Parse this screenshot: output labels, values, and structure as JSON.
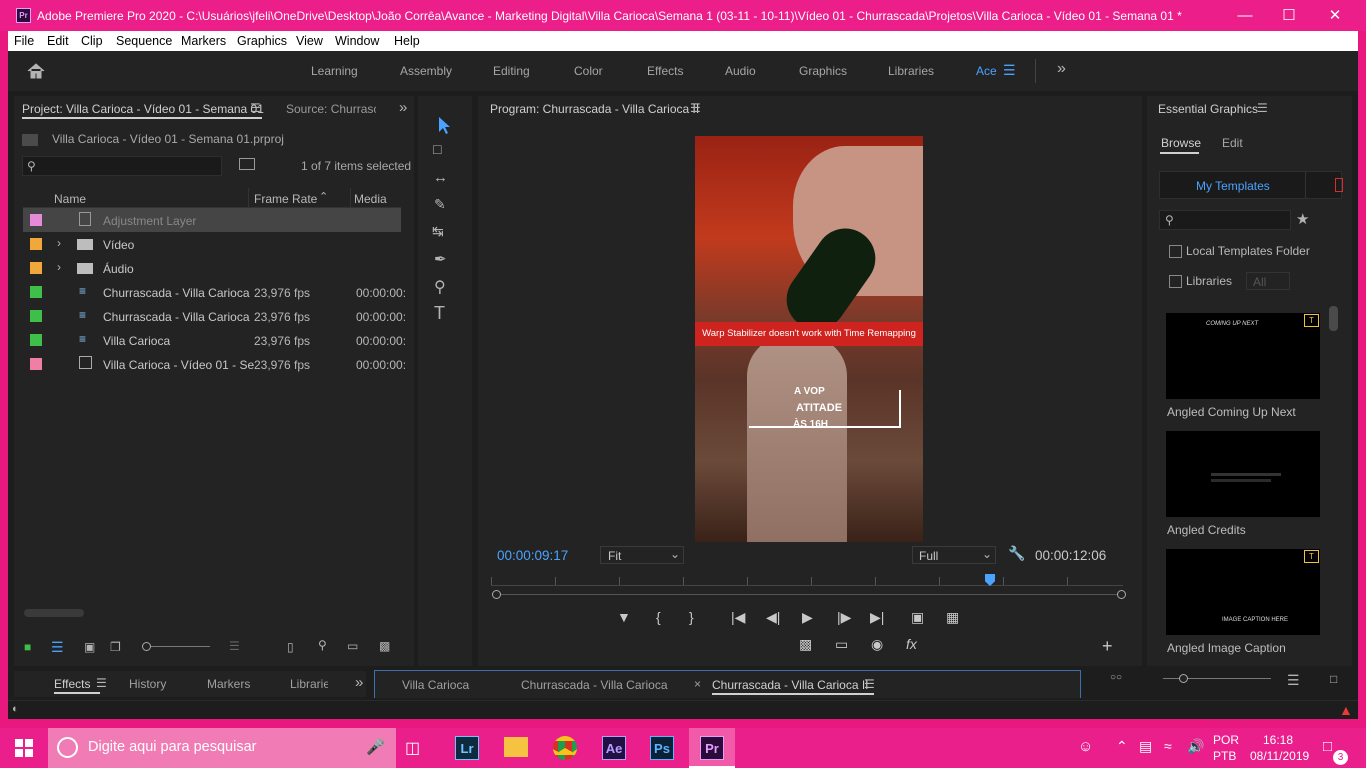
{
  "window": {
    "title": "Adobe Premiere Pro 2020 - C:\\Usuários\\jfeli\\OneDrive\\Desktop\\João Corrêa\\Avance - Marketing Digital\\Villa Carioca\\Semana 1 (03-11 - 10-11)\\Vídeo 01 - Churrascada\\Projetos\\Villa Carioca - Vídeo 01 - Semana 01 *",
    "app_icon": "Pr"
  },
  "menu": [
    "File",
    "Edit",
    "Clip",
    "Sequence",
    "Markers",
    "Graphics",
    "View",
    "Window",
    "Help"
  ],
  "workspaces": {
    "items": [
      "Learning",
      "Assembly",
      "Editing",
      "Color",
      "Effects",
      "Audio",
      "Graphics",
      "Libraries",
      "Ace"
    ],
    "active": "Ace"
  },
  "project": {
    "tab_title": "Project: Villa Carioca - Vídeo 01 - Semana 01",
    "source_tab": "Source: Churrasca",
    "file": "Villa Carioca - Vídeo 01 - Semana 01.prproj",
    "selection": "1 of 7 items selected",
    "columns": {
      "name": "Name",
      "frame_rate": "Frame Rate",
      "media_start": "Media Sta"
    },
    "items": [
      {
        "name": "Adjustment Layer",
        "frame_rate": "",
        "media_start": "",
        "color": "#e58ad9"
      },
      {
        "name": "Vídeo",
        "frame_rate": "",
        "media_start": "",
        "color": "#f0a83b"
      },
      {
        "name": "Áudio",
        "frame_rate": "",
        "media_start": "",
        "color": "#f0a83b"
      },
      {
        "name": "Churrascada - Villa Carioca",
        "frame_rate": "23,976 fps",
        "media_start": "00:00:00:",
        "color": "#3fbf4a"
      },
      {
        "name": "Churrascada - Villa Carioca",
        "frame_rate": "23,976 fps",
        "media_start": "00:00:00:",
        "color": "#3fbf4a"
      },
      {
        "name": "Villa Carioca",
        "frame_rate": "23,976 fps",
        "media_start": "00:00:00:",
        "color": "#3fbf4a"
      },
      {
        "name": "Villa Carioca - Vídeo 01 - Se",
        "frame_rate": "23,976 fps",
        "media_start": "00:00:00:",
        "color": "#f07fa6"
      }
    ]
  },
  "bottom_tabs": {
    "left": [
      "Effects",
      "History",
      "Markers",
      "Librarie"
    ],
    "sequences": [
      "Villa Carioca",
      "Churrascada - Villa Carioca",
      "Churrascada - Villa Carioca II"
    ]
  },
  "program": {
    "title": "Program: Churrascada - Villa Carioca II",
    "current_time": "00:00:09:17",
    "duration": "00:00:12:06",
    "zoom": "Fit",
    "resolution": "Full",
    "warning": "Warp Stabilizer doesn't work with Time Remapping",
    "overlay_lines": [
      "A VOP",
      "ATITADE",
      "ÀS 16H"
    ]
  },
  "essential_graphics": {
    "title": "Essential Graphics",
    "tabs": [
      "Browse",
      "Edit"
    ],
    "dropdown": "My Templates",
    "local_templates": "Local Templates Folder",
    "libraries": "Libraries",
    "libraries_select": "All",
    "templates": [
      {
        "name": "Angled Coming Up Next",
        "preview_text": "COMING UP NEXT"
      },
      {
        "name": "Angled Credits",
        "preview_text": ""
      },
      {
        "name": "Angled Image Caption",
        "preview_text": "IMAGE CAPTION HERE"
      }
    ]
  },
  "taskbar": {
    "search_placeholder": "Digite aqui para pesquisar",
    "apps": [
      "Lr",
      "Ae",
      "Ps",
      "Pr"
    ],
    "lang1": "POR",
    "lang2": "PTB",
    "time": "16:18",
    "date": "08/11/2019",
    "notif_count": "3"
  }
}
